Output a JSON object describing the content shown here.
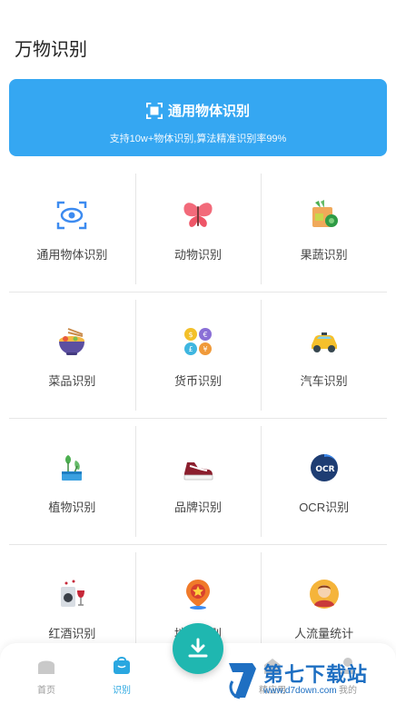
{
  "header": {
    "title": "万物识别"
  },
  "hero": {
    "title": "通用物体识别",
    "subtitle": "支持10w+物体识别,算法精准识别率99%",
    "icon": "scan-icon"
  },
  "grid": {
    "rows": [
      [
        {
          "label": "通用物体识别",
          "icon": "eye-scan-icon"
        },
        {
          "label": "动物识别",
          "icon": "butterfly-icon"
        },
        {
          "label": "果蔬识别",
          "icon": "vegetable-basket-icon"
        }
      ],
      [
        {
          "label": "菜品识别",
          "icon": "noodle-bowl-icon"
        },
        {
          "label": "货币识别",
          "icon": "coins-icon"
        },
        {
          "label": "汽车识别",
          "icon": "car-icon"
        }
      ],
      [
        {
          "label": "植物识别",
          "icon": "plant-icon"
        },
        {
          "label": "品牌识别",
          "icon": "sneaker-icon"
        },
        {
          "label": "OCR识别",
          "icon": "ocr-icon"
        }
      ],
      [
        {
          "label": "红酒识别",
          "icon": "wine-icon"
        },
        {
          "label": "地标识别",
          "icon": "landmark-pin-icon"
        },
        {
          "label": "人流量统计",
          "icon": "person-icon"
        }
      ]
    ]
  },
  "bottom_nav": {
    "items": [
      {
        "label": "首页",
        "icon": "home-icon",
        "active": false
      },
      {
        "label": "识别",
        "icon": "bag-icon",
        "active": true
      },
      {
        "label": "精应用",
        "icon": "apps-icon",
        "active": false
      },
      {
        "label": "我的",
        "icon": "user-icon",
        "active": false
      }
    ],
    "fab_icon": "download-icon"
  },
  "watermark": {
    "text": "第七下载站",
    "url": "www.d7down.com"
  },
  "colors": {
    "primary": "#35a7f2",
    "fab": "#1fb7b0",
    "nav_active": "#2aa7e0",
    "watermark": "#1e6fc2"
  }
}
